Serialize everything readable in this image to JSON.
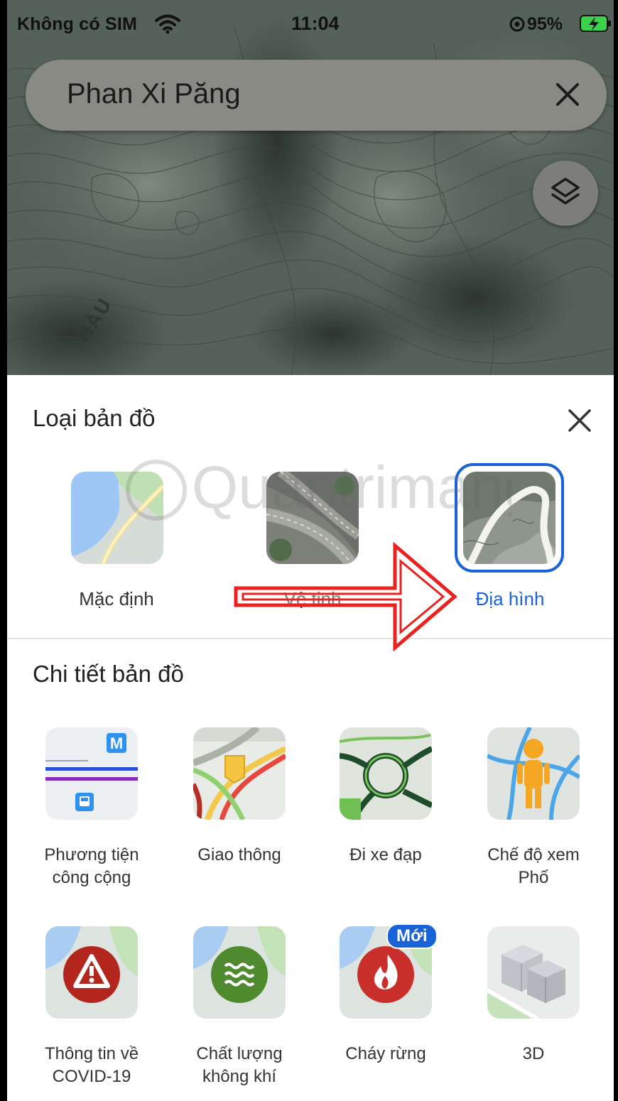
{
  "status_bar": {
    "carrier": "Không có SIM",
    "time": "11:04",
    "battery_percent": "95%"
  },
  "search": {
    "query": "Phan Xi Păng"
  },
  "map": {
    "label": "HẦU"
  },
  "map_type": {
    "title": "Loại bản đồ",
    "options": [
      {
        "label": "Mặc định",
        "selected": false
      },
      {
        "label": "Vệ tinh",
        "selected": false
      },
      {
        "label": "Địa hình",
        "selected": true
      }
    ]
  },
  "map_details": {
    "title": "Chi tiết bản đồ",
    "items": [
      {
        "label_line1": "Phương tiện",
        "label_line2": "công cộng"
      },
      {
        "label_line1": "Giao thông",
        "label_line2": ""
      },
      {
        "label_line1": "Đi xe đạp",
        "label_line2": ""
      },
      {
        "label_line1": "Chế độ xem",
        "label_line2": "Phố"
      },
      {
        "label_line1": "Thông tin về",
        "label_line2": "COVID-19"
      },
      {
        "label_line1": "Chất lượng",
        "label_line2": "không khí"
      },
      {
        "label_line1": "Cháy rừng",
        "label_line2": ""
      },
      {
        "label_line1": "3D",
        "label_line2": ""
      }
    ],
    "new_badge": "Mới"
  },
  "watermark": "Quantrimang",
  "colors": {
    "accent": "#1a63d6",
    "annotation": "#e8231f"
  }
}
